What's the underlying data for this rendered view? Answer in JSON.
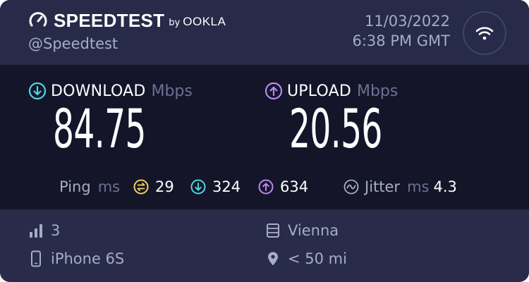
{
  "brand": {
    "name": "SPEEDTEST",
    "by": "by",
    "partner": "OOKLA",
    "handle": "@Speedtest"
  },
  "datetime": {
    "date": "11/03/2022",
    "time": "6:38 PM GMT"
  },
  "download": {
    "label": "DOWNLOAD",
    "unit": "Mbps",
    "value": "84.75",
    "color": "#4fd6e0"
  },
  "upload": {
    "label": "UPLOAD",
    "unit": "Mbps",
    "value": "20.56",
    "color": "#b989f4"
  },
  "ping": {
    "label": "Ping",
    "unit": "ms",
    "idle": "29",
    "download": "324",
    "upload": "634",
    "idle_color": "#f2d35a"
  },
  "jitter": {
    "label": "Jitter",
    "unit": "ms",
    "value": "4.3"
  },
  "footer": {
    "connections": "3",
    "device": "iPhone 6S",
    "server": "Vienna",
    "distance": "< 50 mi"
  },
  "icons": {
    "brand": "speedometer-icon",
    "connection": "wifi-icon",
    "download": "arrow-down-circle-icon",
    "upload": "arrow-up-circle-icon",
    "ping_idle": "ping-idle-icon",
    "jitter": "jitter-icon",
    "connections": "signal-bars-icon",
    "device": "phone-icon",
    "server": "server-icon",
    "location": "location-pin-icon"
  }
}
